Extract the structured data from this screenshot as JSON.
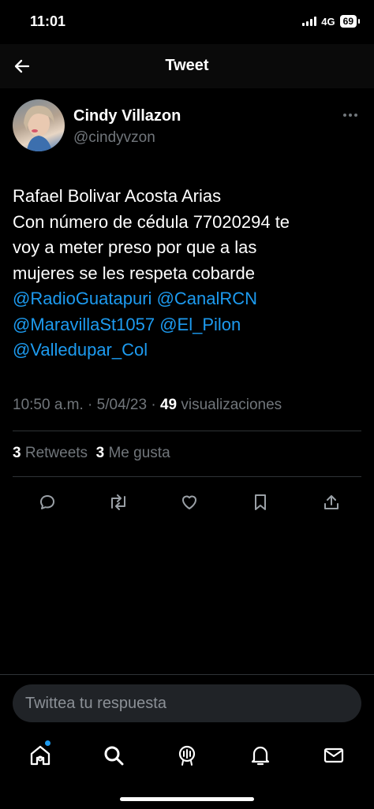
{
  "status_bar": {
    "time": "11:01",
    "network": "4G",
    "battery": "69"
  },
  "header": {
    "title": "Tweet"
  },
  "author": {
    "display_name": "Cindy Villazon",
    "handle": "@cindyvzon"
  },
  "tweet": {
    "lines": [
      "Rafael Bolivar Acosta Arias",
      "Con número de cédula 77020294 te",
      "voy a meter preso por que a las",
      "mujeres se les respeta cobarde"
    ],
    "mentions": [
      "@RadioGuatapuri",
      "@CanalRCN",
      "@MaravillaSt1057",
      "@El_Pilon",
      "@Valledupar_Col"
    ],
    "time": "10:50 a.m.",
    "separator": " · ",
    "date": "5/04/23",
    "views_count": "49",
    "views_label": "visualizaciones"
  },
  "stats": {
    "retweets_count": "3",
    "retweets_label": "Retweets",
    "likes_count": "3",
    "likes_label": "Me gusta"
  },
  "actions": [
    "reply-icon",
    "retweet-icon",
    "like-icon",
    "bookmark-icon",
    "share-icon"
  ],
  "reply": {
    "placeholder": "Twittea tu respuesta"
  },
  "tabs": [
    "home-icon",
    "search-icon",
    "spaces-icon",
    "notifications-icon",
    "messages-icon"
  ],
  "colors": {
    "accent": "#1d9bf0",
    "background": "#000000",
    "secondary_text": "#71767b",
    "divider": "#2f3336"
  }
}
